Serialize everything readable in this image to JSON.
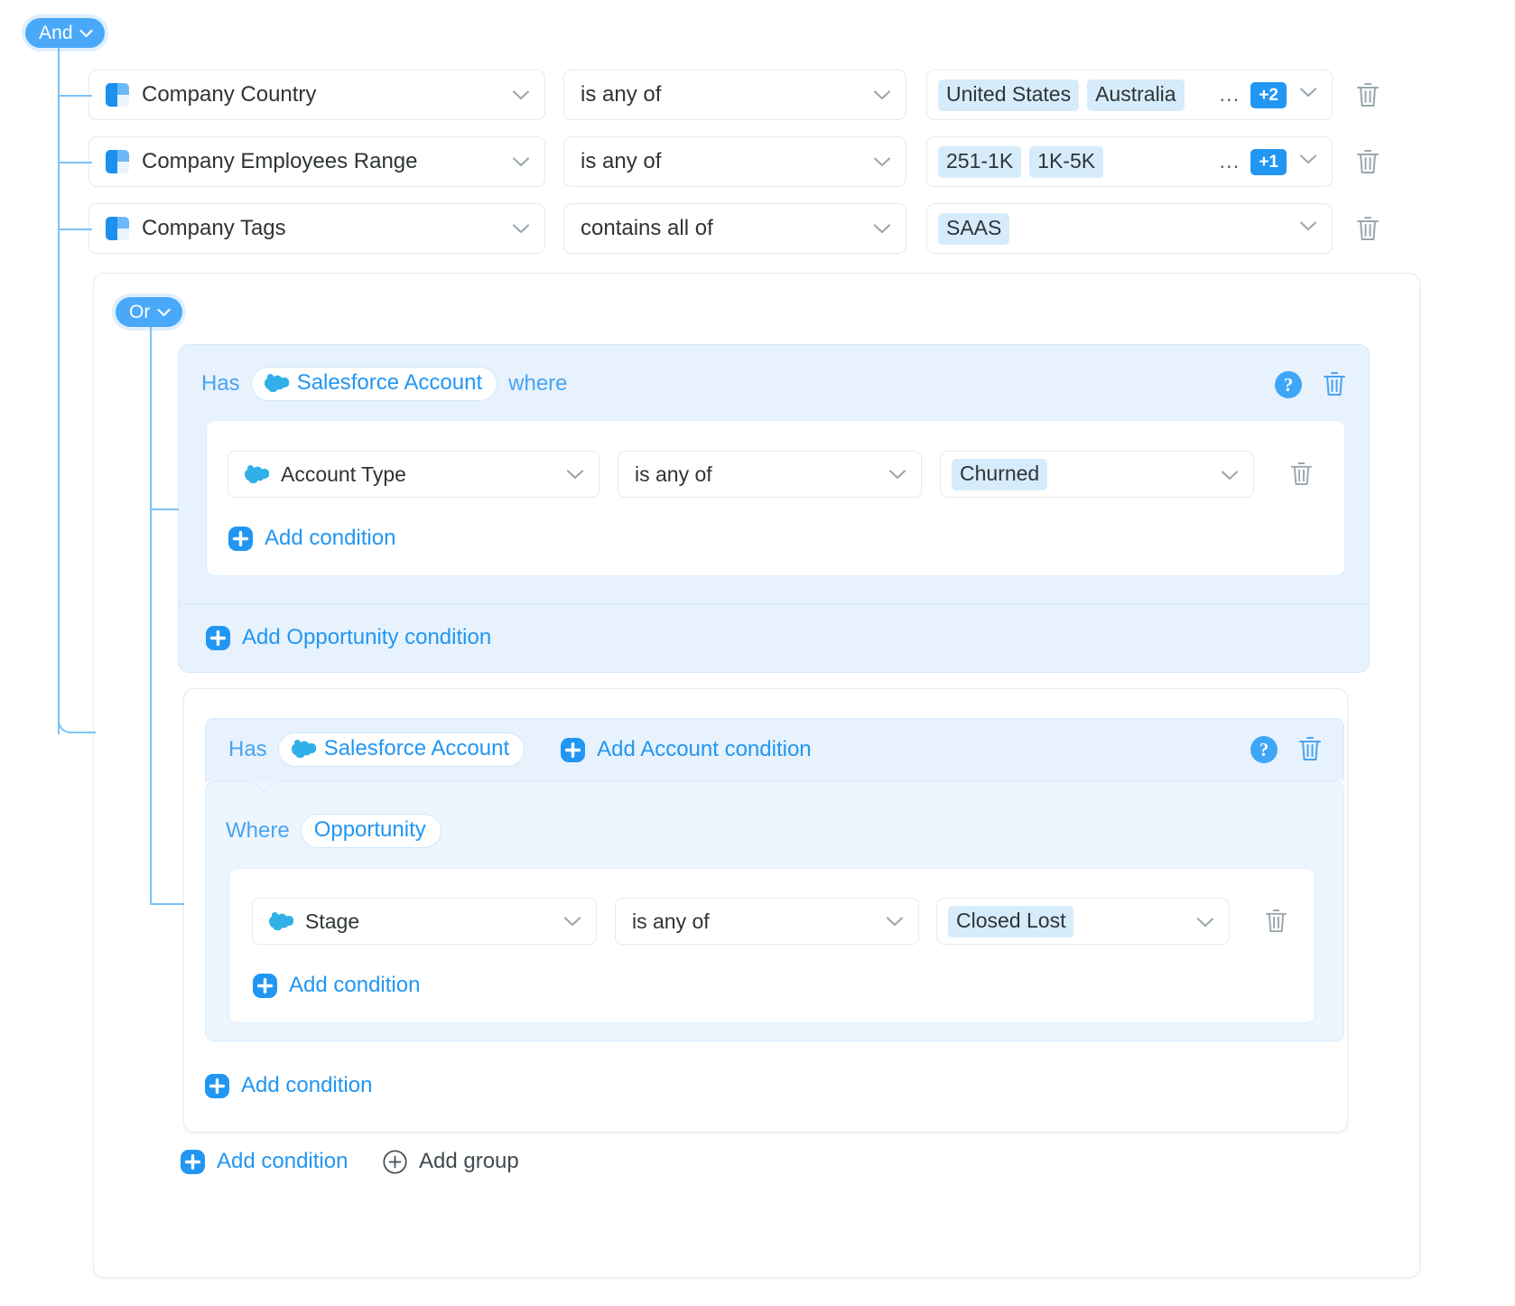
{
  "root": {
    "operator": "And",
    "conditions": [
      {
        "field": "Company Country",
        "field_icon": "clearbit-square-icon",
        "operator": "is any of",
        "values": [
          "United States",
          "Australia"
        ],
        "overflow_ellipsis": "...",
        "overflow_count": "+2"
      },
      {
        "field": "Company Employees Range",
        "field_icon": "clearbit-square-icon",
        "operator": "is any of",
        "values": [
          "251-1K",
          "1K-5K"
        ],
        "overflow_ellipsis": "...",
        "overflow_count": "+1"
      },
      {
        "field": "Company Tags",
        "field_icon": "clearbit-square-icon",
        "operator": "contains all of",
        "values": [
          "SAAS"
        ],
        "overflow_ellipsis": "",
        "overflow_count": ""
      }
    ]
  },
  "group": {
    "operator": "Or",
    "salesforce_block_1": {
      "has_label": "Has",
      "object_pill": "Salesforce Account",
      "object_pill_icon": "salesforce-cloud-icon",
      "where_label": "where",
      "help_label": "?",
      "condition": {
        "field": "Account Type",
        "field_icon": "salesforce-cloud-icon",
        "operator": "is any of",
        "values": [
          "Churned"
        ]
      },
      "add_condition_label": "Add condition",
      "add_opportunity_condition_label": "Add Opportunity condition"
    },
    "salesforce_block_2": {
      "has_label": "Has",
      "object_pill": "Salesforce Account",
      "object_pill_icon": "salesforce-cloud-icon",
      "add_account_condition_label": "Add Account condition",
      "help_label": "?",
      "where_label": "Where",
      "where_pill": "Opportunity",
      "condition": {
        "field": "Stage",
        "field_icon": "salesforce-cloud-icon",
        "operator": "is any of",
        "values": [
          "Closed Lost"
        ]
      },
      "add_condition_inner_label": "Add condition",
      "add_condition_outer_label": "Add condition"
    },
    "footer": {
      "add_condition_label": "Add condition",
      "add_group_label": "Add group"
    }
  },
  "colors": {
    "accent": "#2196f3",
    "badge": "#49a9f8",
    "chip_bg": "#d6ecfb",
    "panel_bg": "#e7f2fd",
    "sub_panel_bg": "#edf6fe",
    "connector": "#7cc2f7",
    "text": "#2f3437"
  },
  "icons": {
    "caret": "chevron-down-icon",
    "trash": "trash-icon",
    "plus_filled": "plus-square-icon",
    "plus_outline": "plus-circle-outline-icon"
  }
}
